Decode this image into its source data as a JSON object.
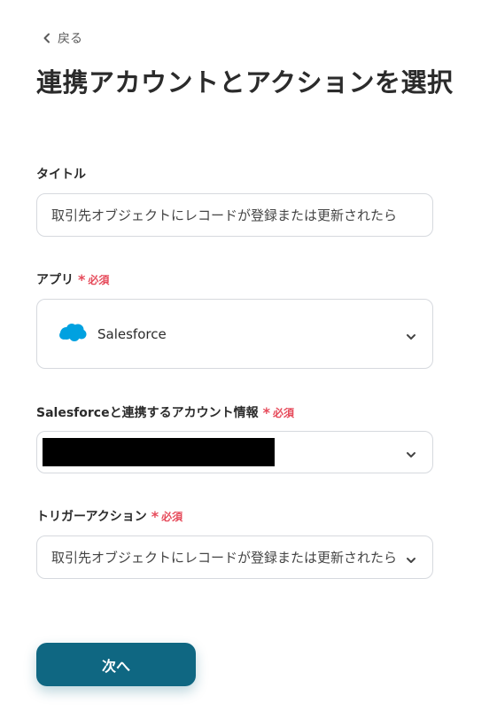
{
  "header": {
    "back_label": "戻る",
    "title": "連携アカウントとアクションを選択"
  },
  "required_label": "必須",
  "fields": {
    "title": {
      "label": "タイトル",
      "value": "取引先オブジェクトにレコードが登録または更新されたら"
    },
    "app": {
      "label": "アプリ",
      "value": "Salesforce",
      "icon": "salesforce-cloud-icon"
    },
    "account": {
      "label": "Salesforceと連携するアカウント情報"
    },
    "trigger": {
      "label": "トリガーアクション",
      "value": "取引先オブジェクトにレコードが登録または更新されたら"
    }
  },
  "next_button_label": "次へ",
  "colors": {
    "accent": "#0f6782",
    "required": "#e64a5a",
    "salesforce": "#00a1e0",
    "border": "#d6d9de"
  }
}
